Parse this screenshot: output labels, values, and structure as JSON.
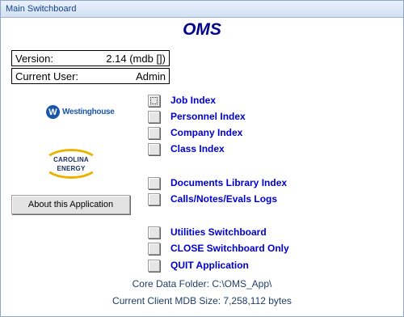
{
  "window": {
    "title": "Main Switchboard"
  },
  "app_title": "OMS",
  "info": {
    "version_label": "Version:",
    "version_value": "2.14 (mdb [])",
    "user_label": "Current User:",
    "user_value": "Admin"
  },
  "logos": {
    "westinghouse": {
      "symbol": "W",
      "text": "Westinghouse"
    },
    "carolina": {
      "line1": "CAROLINA",
      "line2": "ENERGY"
    }
  },
  "about_button": "About this Application",
  "menu": [
    {
      "label": "Job Index"
    },
    {
      "label": "Personnel Index"
    },
    {
      "label": "Company Index"
    },
    {
      "label": "Class Index"
    },
    {
      "label": "Documents Library Index"
    },
    {
      "label": "Calls/Notes/Evals Logs"
    },
    {
      "label": "Utilities Switchboard"
    },
    {
      "label": "CLOSE Switchboard Only"
    },
    {
      "label": "QUIT Application"
    }
  ],
  "footer": {
    "core_data_folder": "Core Data Folder: C:\\OMS_App\\",
    "mdb_size": "Current Client MDB Size: 7,258,112 bytes"
  },
  "colors": {
    "title_blue": "#00008b",
    "link_blue": "#0000cd",
    "westinghouse_blue": "#1a56a8",
    "carolina_gold": "#e8b400"
  }
}
